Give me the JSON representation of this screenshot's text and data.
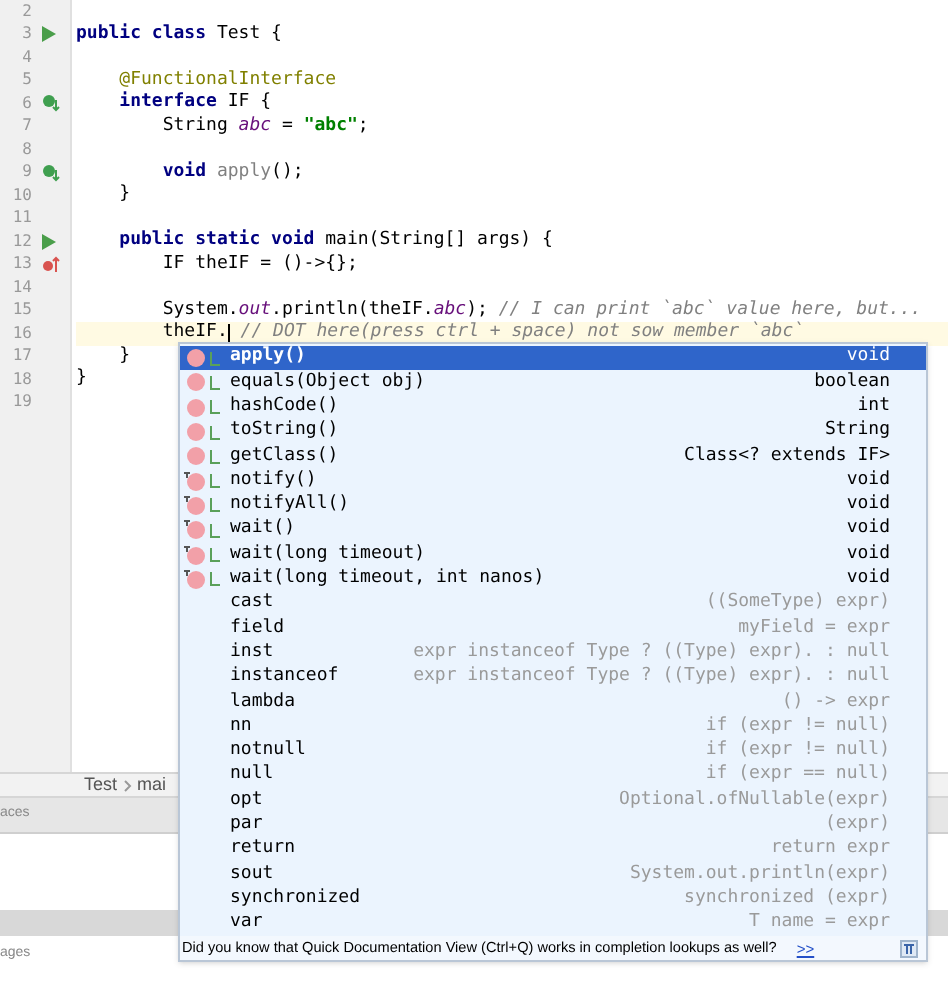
{
  "editor": {
    "lines": [
      {
        "number": "2"
      },
      {
        "number": "3",
        "gutter_icon": {
          "kind": "run"
        },
        "tokens": [
          {
            "kind": "keyword",
            "text": "public class"
          },
          {
            "kind": "plain",
            "text": " Test {"
          }
        ]
      },
      {
        "number": "4"
      },
      {
        "number": "5",
        "tokens": [
          {
            "kind": "annotation",
            "text": "    @FunctionalInterface"
          }
        ]
      },
      {
        "number": "6",
        "gutter_icon": {
          "kind": "implemented"
        },
        "tokens": [
          {
            "kind": "keyword",
            "text": "    interface"
          },
          {
            "kind": "plain",
            "text": " IF {"
          }
        ]
      },
      {
        "number": "7",
        "tokens": [
          {
            "kind": "plain",
            "text": "        String "
          },
          {
            "kind": "static",
            "text": "abc"
          },
          {
            "kind": "plain",
            "text": " = "
          },
          {
            "kind": "string",
            "text": "\"abc\""
          },
          {
            "kind": "plain",
            "text": ";"
          }
        ]
      },
      {
        "number": "8"
      },
      {
        "number": "9",
        "gutter_icon": {
          "kind": "implemented"
        },
        "tokens": [
          {
            "kind": "keyword",
            "text": "        void"
          },
          {
            "kind": "unused",
            "text": " apply"
          },
          {
            "kind": "plain",
            "text": "();"
          }
        ]
      },
      {
        "number": "10",
        "tokens": [
          {
            "kind": "plain",
            "text": "    }"
          }
        ]
      },
      {
        "number": "11"
      },
      {
        "number": "12",
        "gutter_icon": {
          "kind": "run"
        },
        "tokens": [
          {
            "kind": "keyword",
            "text": "    public static void"
          },
          {
            "kind": "plain",
            "text": " main(String[] args) {"
          }
        ]
      },
      {
        "number": "13",
        "gutter_icon": {
          "kind": "implementing"
        },
        "tokens": [
          {
            "kind": "plain",
            "text": "        IF theIF = ()->{};"
          }
        ]
      },
      {
        "number": "14"
      },
      {
        "number": "15",
        "tokens": [
          {
            "kind": "plain",
            "text": "        System."
          },
          {
            "kind": "static",
            "text": "out"
          },
          {
            "kind": "plain",
            "text": ".println(theIF."
          },
          {
            "kind": "static",
            "text": "abc"
          },
          {
            "kind": "plain",
            "text": "); "
          },
          {
            "kind": "comment",
            "text": "// I can print `abc` value here, but..."
          }
        ]
      },
      {
        "number": "16",
        "current": true,
        "tokens": [
          {
            "kind": "plain",
            "text": "        theIF.",
            "caret_after": true
          },
          {
            "kind": "comment",
            "text": " // DOT here(press ctrl + space) not sow member `abc`"
          }
        ]
      },
      {
        "number": "17",
        "tokens": [
          {
            "kind": "plain",
            "text": "    }"
          }
        ]
      },
      {
        "number": "18",
        "tokens": [
          {
            "kind": "plain",
            "text": "}"
          }
        ]
      },
      {
        "number": "19"
      }
    ]
  },
  "breadcrumb": [
    "Test",
    "mai"
  ],
  "panels": [
    {
      "label": "aces"
    },
    {
      "label": "ages"
    }
  ],
  "completion": {
    "items": [
      {
        "kind": "method",
        "name": "apply()",
        "type": "void",
        "selected": true,
        "final": false
      },
      {
        "kind": "method",
        "name": "equals(Object obj)",
        "type": "boolean",
        "selected": false,
        "final": false
      },
      {
        "kind": "method",
        "name": "hashCode()",
        "type": "int",
        "selected": false,
        "final": false
      },
      {
        "kind": "method",
        "name": "toString()",
        "type": "String",
        "selected": false,
        "final": false
      },
      {
        "kind": "method",
        "name": "getClass()",
        "type": "Class<? extends IF>",
        "selected": false,
        "final": false
      },
      {
        "kind": "method",
        "name": "notify()",
        "type": "void",
        "selected": false,
        "final": true
      },
      {
        "kind": "method",
        "name": "notifyAll()",
        "type": "void",
        "selected": false,
        "final": true
      },
      {
        "kind": "method",
        "name": "wait()",
        "type": "void",
        "selected": false,
        "final": true
      },
      {
        "kind": "method",
        "name": "wait(long timeout)",
        "type": "void",
        "selected": false,
        "final": true
      },
      {
        "kind": "method",
        "name": "wait(long timeout, int nanos)",
        "type": "void",
        "selected": false,
        "final": true
      },
      {
        "kind": "template",
        "name": "cast",
        "type": "((SomeType) expr)",
        "selected": false
      },
      {
        "kind": "template",
        "name": "field",
        "type": "myField = expr",
        "selected": false
      },
      {
        "kind": "template",
        "name": "inst",
        "type": "expr instanceof Type ? ((Type) expr). : null",
        "selected": false
      },
      {
        "kind": "template",
        "name": "instanceof",
        "type": "expr instanceof Type ? ((Type) expr). : null",
        "selected": false
      },
      {
        "kind": "template",
        "name": "lambda",
        "type": "() -> expr",
        "selected": false
      },
      {
        "kind": "template",
        "name": "nn",
        "type": "if (expr != null)",
        "selected": false
      },
      {
        "kind": "template",
        "name": "notnull",
        "type": "if (expr != null)",
        "selected": false
      },
      {
        "kind": "template",
        "name": "null",
        "type": "if (expr == null)",
        "selected": false
      },
      {
        "kind": "template",
        "name": "opt",
        "type": "Optional.ofNullable(expr)",
        "selected": false
      },
      {
        "kind": "template",
        "name": "par",
        "type": "(expr)",
        "selected": false
      },
      {
        "kind": "template",
        "name": "return",
        "type": "return expr",
        "selected": false
      },
      {
        "kind": "template",
        "name": "sout",
        "type": "System.out.println(expr)",
        "selected": false
      },
      {
        "kind": "template",
        "name": "synchronized",
        "type": "synchronized (expr)",
        "selected": false
      },
      {
        "kind": "template",
        "name": "var",
        "type": "T name = expr",
        "selected": false
      }
    ],
    "tip": "Did you know that Quick Documentation View (Ctrl+Q) works in completion lookups as well?",
    "tip_link": ">>"
  }
}
